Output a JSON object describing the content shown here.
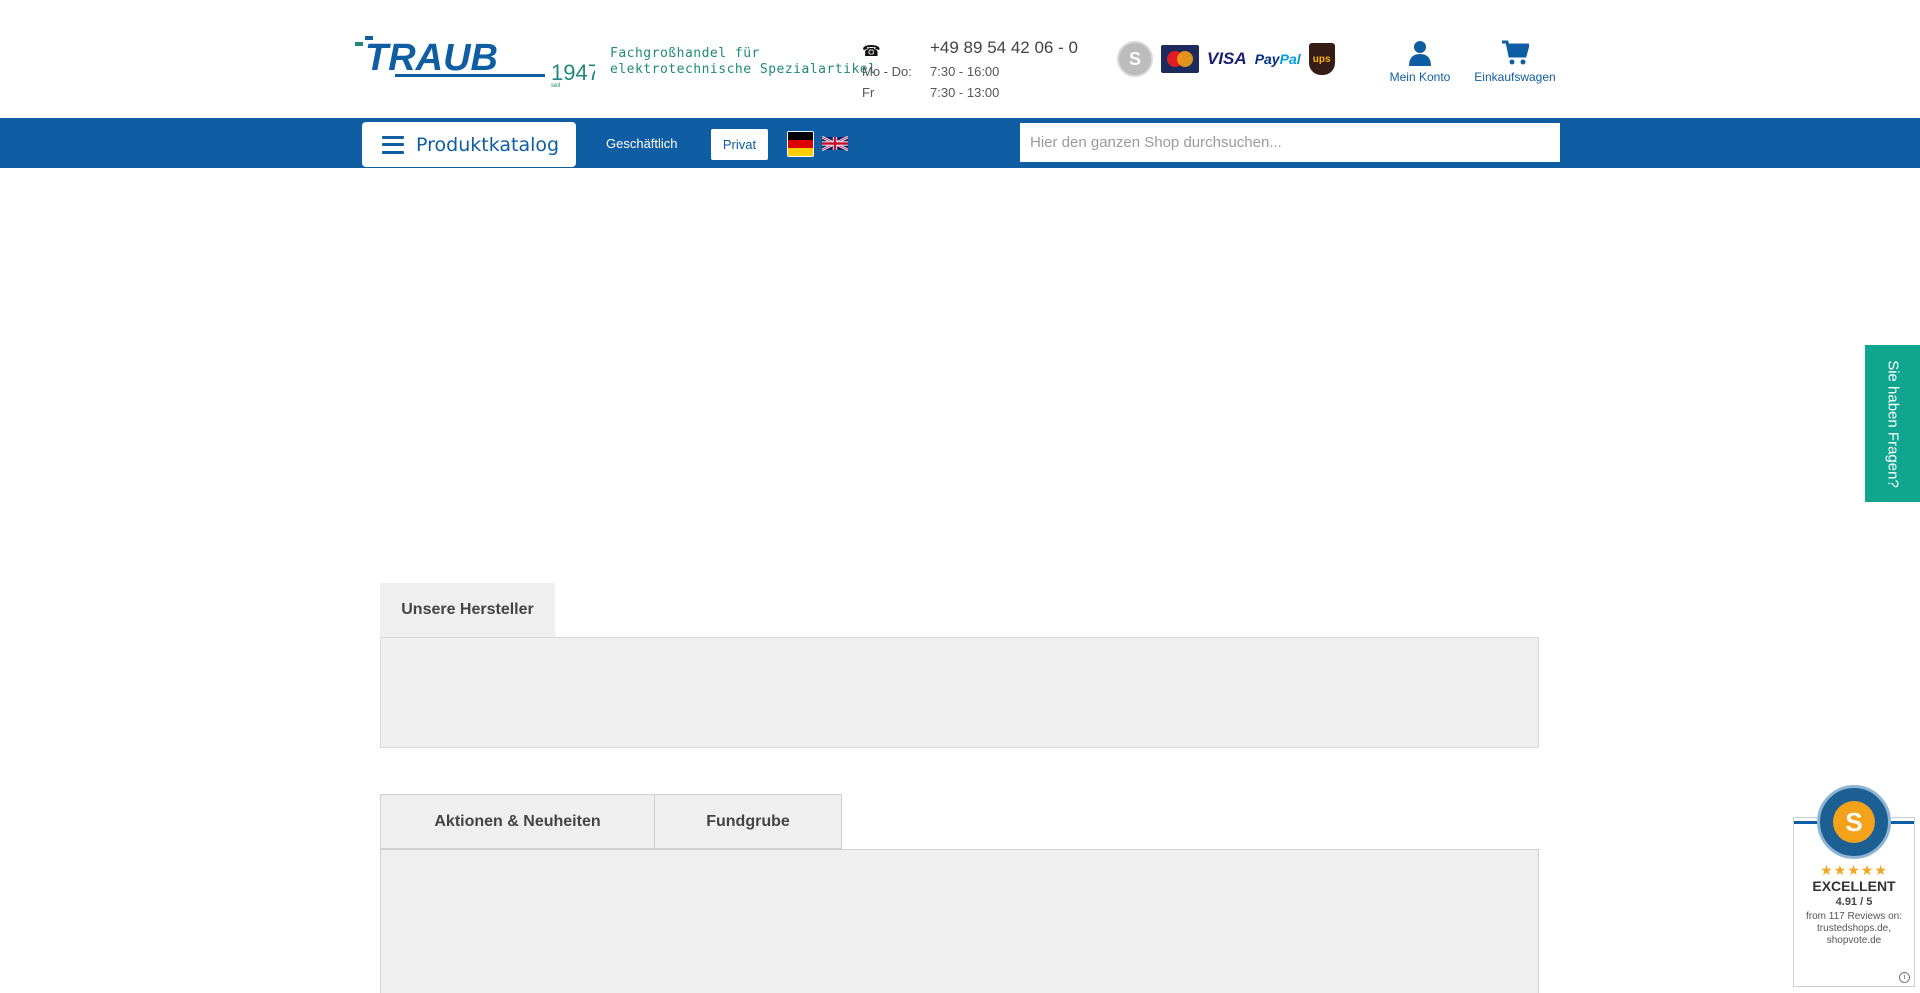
{
  "header": {
    "logo_text": "TRAUB",
    "logo_year": "1947",
    "logo_since": "seit",
    "tagline_line1": "Fachgroßhandel für",
    "tagline_line2": "elektrotechnische Spezialartikel",
    "phone_icon": "phone-icon",
    "phone": "+49 89 54 42 06 - 0",
    "hours": [
      {
        "days": "Mo - Do:",
        "time": "7:30 - 16:00"
      },
      {
        "days": "Fr",
        "time": "7:30 - 13:00"
      }
    ],
    "payments": {
      "s_label": "S",
      "visa": "VISA",
      "paypal_1": "Pay",
      "paypal_2": "Pal",
      "ups": "ups"
    },
    "account_label": "Mein Konto",
    "cart_label": "Einkaufswagen"
  },
  "nav": {
    "catalog_label": "Produktkatalog",
    "business_label": "Geschäftlich",
    "private_label": "Privat",
    "search_placeholder": "Hier den ganzen Shop durchsuchen..."
  },
  "side_tab": {
    "label": "Sie haben Fragen?"
  },
  "sections": {
    "manufacturers_tab": "Unsere Hersteller",
    "tabs": [
      {
        "label": "Aktionen & Neuheiten"
      },
      {
        "label": "Fundgrube"
      }
    ]
  },
  "badge": {
    "seal_letter": "S",
    "stars": "★★★★★",
    "rating": "EXCELLENT",
    "score": "4.91 / 5",
    "from": "from 117 Reviews on: trustedshops.de, shopvote.de"
  },
  "colors": {
    "brand_blue": "#0f5ea3",
    "teal": "#10a58f",
    "panel_gray": "#efefef"
  }
}
